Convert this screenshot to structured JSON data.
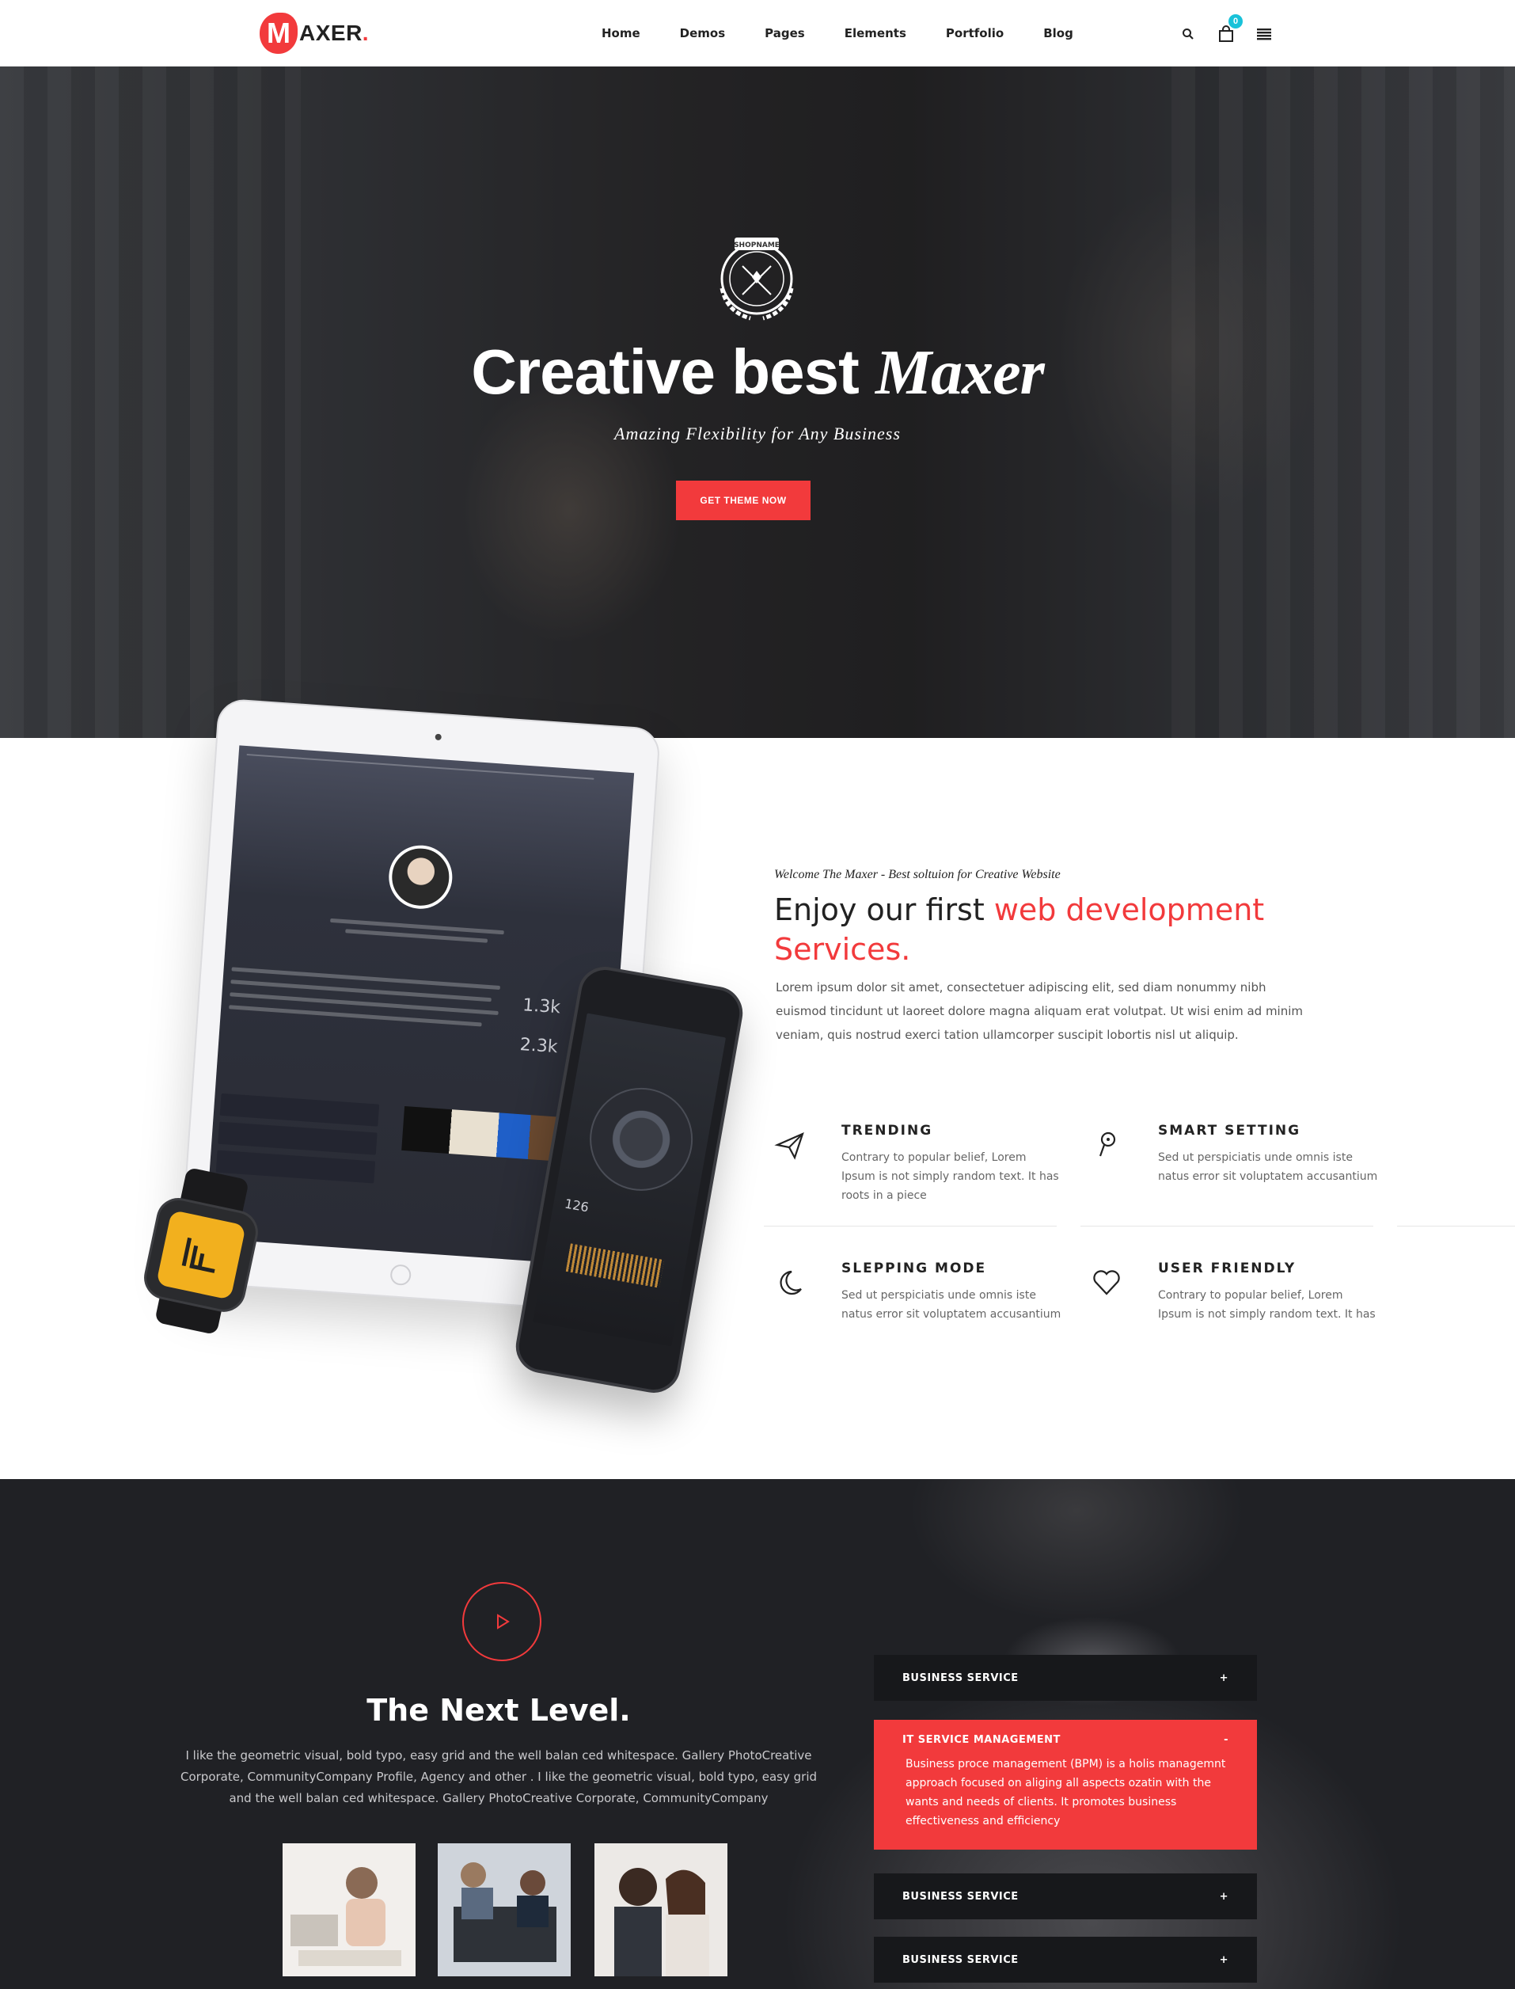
{
  "header": {
    "logo_letter": "M",
    "logo_rest": "AXER",
    "logo_dot": ".",
    "nav": [
      "Home",
      "Demos",
      "Pages",
      "Elements",
      "Portfolio",
      "Blog"
    ],
    "cart_count": "0",
    "icons": [
      "search-icon",
      "shopping-bag-icon",
      "menu-icon"
    ],
    "accent_color": "#f23a3c",
    "badge_color": "#19c2d9"
  },
  "hero": {
    "emblem_text": "SHOPNAME",
    "title_main": "Creative best ",
    "title_accent": "Maxer",
    "subtitle": "Amazing Flexibility for Any Business",
    "button_label": "GET THEME NOW"
  },
  "devices": {
    "tablet_stats": [
      "1.3k",
      "2.3k"
    ],
    "phone_number": "126"
  },
  "welcome": {
    "kicker": "Welcome The Maxer - Best soltuion for Creative Website",
    "title_plain": "Enjoy our first ",
    "title_red": "web development Services.",
    "text": "Lorem ipsum dolor sit amet, consectetuer adipiscing elit, sed diam nonummy nibh euismod tincidunt ut laoreet dolore magna aliquam erat volutpat. Ut wisi enim ad minim veniam, quis nostrud exerci tation ullamcorper suscipit lobortis nisl ut aliquip."
  },
  "features": [
    {
      "icon": "paper-plane-icon",
      "title": "TRENDING",
      "text": "Contrary to popular belief, Lorem Ipsum is not simply random text. It has roots in a piece"
    },
    {
      "icon": "pin-icon",
      "title": "SMART SETTING",
      "text": "Sed ut perspiciatis unde omnis iste natus error sit voluptatem accusantium"
    },
    {
      "icon": "moon-icon",
      "title": "SLEPPING MODE",
      "text": "Sed ut perspiciatis unde omnis iste natus error sit voluptatem accusantium"
    },
    {
      "icon": "heart-icon",
      "title": "USER FRIENDLY",
      "text": "Contrary to popular belief, Lorem Ipsum is not simply random text. It has"
    }
  ],
  "next_level": {
    "play_icon": "play-icon",
    "title": "The Next Level.",
    "text": "I like the geometric visual, bold typo, easy grid and the well balan ced whitespace. Gallery PhotoCreative Corporate, CommunityCompany Profile, Agency and other . I like the geometric visual, bold typo, easy grid and the well balan ced whitespace. Gallery PhotoCreative Corporate, CommunityCompany"
  },
  "accordion": [
    {
      "title": "BUSINESS SERVICE",
      "toggle": "+",
      "active": false
    },
    {
      "title": "IT SERVICE MANAGEMENT",
      "toggle": "-",
      "active": true,
      "body": "Business proce management (BPM) is a holis managemnt approach focused on aliging all aspects ozatin with the wants and needs of clients. It promotes business effectiveness and efficiency"
    },
    {
      "title": "BUSINESS SERVICE",
      "toggle": "+",
      "active": false
    },
    {
      "title": "BUSINESS SERVICE",
      "toggle": "+",
      "active": false
    }
  ]
}
